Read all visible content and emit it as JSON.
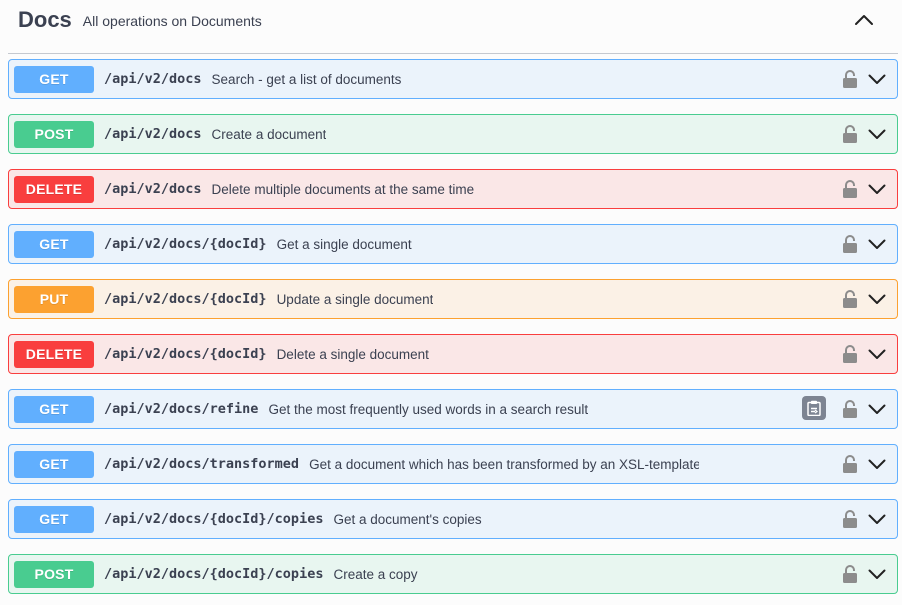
{
  "tag": {
    "title": "Docs",
    "description": "All operations on Documents",
    "toggle_icon": "chevron-up-icon"
  },
  "operations": [
    {
      "method": "GET",
      "path": "/api/v2/docs",
      "summary": "Search - get a list of documents"
    },
    {
      "method": "POST",
      "path": "/api/v2/docs",
      "summary": "Create a document"
    },
    {
      "method": "DELETE",
      "path": "/api/v2/docs",
      "summary": "Delete multiple documents at the same time"
    },
    {
      "method": "GET",
      "path": "/api/v2/docs/{docId}",
      "summary": "Get a single document"
    },
    {
      "method": "PUT",
      "path": "/api/v2/docs/{docId}",
      "summary": "Update a single document"
    },
    {
      "method": "DELETE",
      "path": "/api/v2/docs/{docId}",
      "summary": "Delete a single document"
    },
    {
      "method": "GET",
      "path": "/api/v2/docs/refine",
      "summary": "Get the most frequently used words in a search result"
    },
    {
      "method": "GET",
      "path": "/api/v2/docs/transformed",
      "summary": "Get a document which has been transformed by an XSL-template"
    },
    {
      "method": "GET",
      "path": "/api/v2/docs/{docId}/copies",
      "summary": "Get a document's copies"
    },
    {
      "method": "POST",
      "path": "/api/v2/docs/{docId}/copies",
      "summary": "Create a copy"
    }
  ],
  "colors": {
    "get": "#61affe",
    "post": "#49cc90",
    "delete": "#f93e3e",
    "put": "#fca130",
    "text": "#3b4151",
    "icon": "#7d8492"
  },
  "icons": {
    "lock": "lock-icon",
    "expand": "chevron-down-icon",
    "copy": "clipboard-icon"
  }
}
